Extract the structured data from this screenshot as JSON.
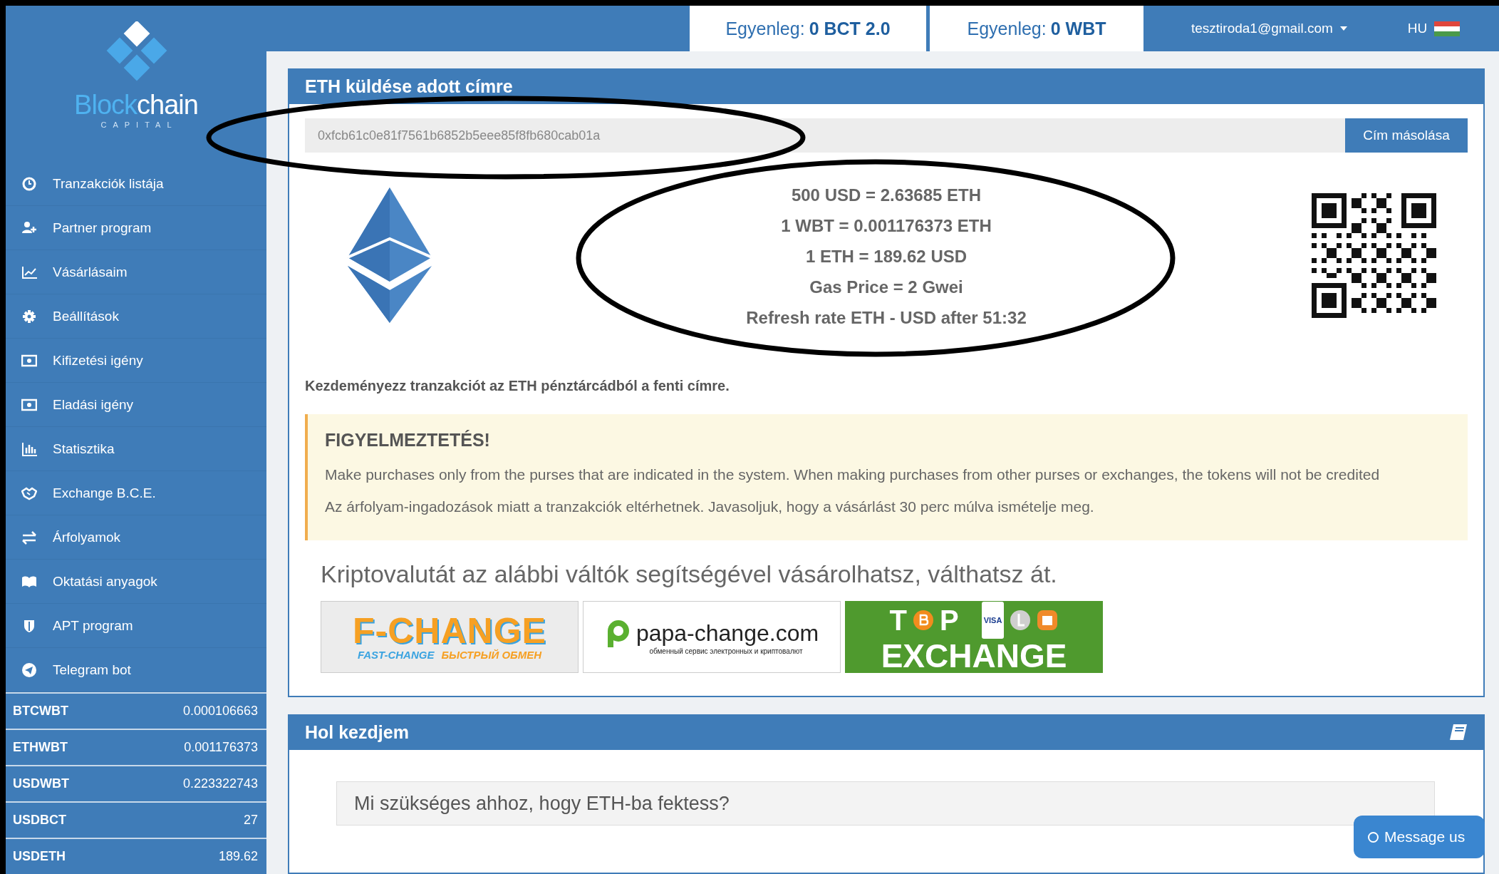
{
  "topbar": {
    "balances": [
      {
        "label": "Egyenleg:",
        "amount": "0 BCT 2.0"
      },
      {
        "label": "Egyenleg:",
        "amount": "0 WBT"
      }
    ],
    "user_menu": "tesztiroda1@gmail.com",
    "language": "HU"
  },
  "sidebar": {
    "logo": {
      "wordmark": [
        "Block",
        "chain"
      ],
      "tagline": "CAPITAL"
    },
    "menu": [
      {
        "label": "Tranzakciók listája"
      },
      {
        "label": "Partner program"
      },
      {
        "label": "Vásárlásaim"
      },
      {
        "label": "Beállítások"
      },
      {
        "label": "Kifizetési igény"
      },
      {
        "label": "Eladási igény"
      },
      {
        "label": "Statisztika"
      },
      {
        "label": "Exchange B.C.E."
      },
      {
        "label": "Árfolyamok"
      },
      {
        "label": "Oktatási anyagok"
      },
      {
        "label": "APT program"
      },
      {
        "label": "Telegram bot"
      }
    ],
    "rates": [
      {
        "pair": "BTCWBT",
        "value": "0.000106663"
      },
      {
        "pair": "ETHWBT",
        "value": "0.001176373"
      },
      {
        "pair": "USDWBT",
        "value": "0.223322743"
      },
      {
        "pair": "USDBCT",
        "value": "27"
      },
      {
        "pair": "USDETH",
        "value": "189.62"
      }
    ]
  },
  "send_panel": {
    "title": "ETH küldése adott címre",
    "address": "0xfcb61c0e81f7561b6852b5eee85f8fb680cab01a",
    "copy_button": "Cím másolása",
    "rate_lines": [
      "500 USD = 2.63685 ETH",
      "1 WBT = 0.001176373 ETH",
      "1 ETH = 189.62 USD",
      "Gas Price = 2 Gwei",
      "Refresh rate ETH - USD after 51:32"
    ],
    "instruction": "Kezdeményezz tranzakciót az ETH pénztárcádból a fenti címre.",
    "warning": {
      "title": "FIGYELMEZTETÉS!",
      "paragraphs": [
        "Make purchases only from the purses that are indicated in the system. When making purchases from other purses or exchanges, the tokens will not be credited",
        "Az árfolyam-ingadozások miatt a tranzakciók eltérhetnek. Javasoljuk, hogy a vásárlást 30 perc múlva ismételje meg."
      ]
    },
    "exchanges": {
      "heading": "Kriptovalutát az alábbi váltók segítségével vásárolhatsz, válthatsz át.",
      "logos": [
        {
          "kind": "fchange",
          "texts": [
            "F-CHANGE",
            "FAST-CHANGE",
            "БЫСТРЫЙ ОБМЕН"
          ]
        },
        {
          "kind": "papa",
          "texts": [
            "papa-change.com",
            "обменный сервис электронных и криптовалют"
          ]
        },
        {
          "kind": "top",
          "texts": [
            "T",
            "P",
            "VISA",
            "EXCHANGE"
          ]
        }
      ]
    }
  },
  "start_panel": {
    "title": "Hol kezdjem",
    "question": "Mi szükséges ahhoz, hogy ETH-ba fektess?"
  },
  "chat_button": "Message us"
}
